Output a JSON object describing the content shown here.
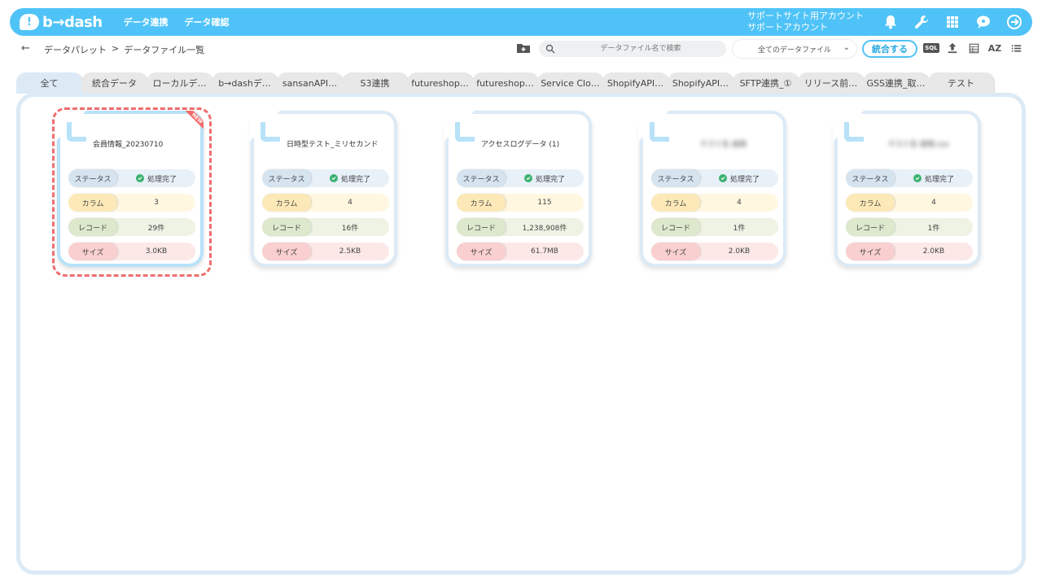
{
  "brand": {
    "name": "b→dash",
    "logo_mark": "!"
  },
  "topnav": [
    "データ連携",
    "データ確認"
  ],
  "account": {
    "line1": "サポートサイト用アカウント",
    "line2": "サポートアカウント"
  },
  "top_icons": [
    "bell-icon",
    "wrench-icon",
    "grid-icon",
    "chat-icon",
    "logout-icon"
  ],
  "breadcrumb": {
    "parent": "データパレット",
    "separator": ">",
    "current": "データファイル一覧"
  },
  "search": {
    "placeholder": "データファイル名で検索"
  },
  "filter": {
    "selected": "全てのデータファイル"
  },
  "toolbar": {
    "merge_label": "統合する",
    "sql_label": "SQL",
    "sort_label": "AZ"
  },
  "tabs": [
    "全て",
    "統合データ",
    "ローカルデ…",
    "b→dashデ…",
    "sansanAPI…",
    "S3連携",
    "futureshop…",
    "futureshop…",
    "Service Clo…",
    "ShopifyAPI…",
    "ShopifyAPI…",
    "SFTP連携_①",
    "リリース前…",
    "GSS連携_取…",
    "テスト"
  ],
  "active_tab": "全て",
  "labels": {
    "status": "ステータス",
    "column": "カラム",
    "record": "レコード",
    "size": "サイズ"
  },
  "new_badge": "NEW",
  "files": [
    {
      "name": "会員情報_20230710",
      "status": "処理完了",
      "columns": "3",
      "records": "29件",
      "size": "3.0KB",
      "is_new": true,
      "selected": true,
      "name_blurred": false
    },
    {
      "name": "日時型テスト_ミリセカンド",
      "status": "処理完了",
      "columns": "4",
      "records": "16件",
      "size": "2.5KB",
      "is_new": false,
      "selected": false,
      "name_blurred": false
    },
    {
      "name": "アクセスログデータ (1)",
      "status": "処理完了",
      "columns": "115",
      "records": "1,238,908件",
      "size": "61.7MB",
      "is_new": false,
      "selected": false,
      "name_blurred": false
    },
    {
      "name": "テスト生 成用",
      "status": "処理完了",
      "columns": "4",
      "records": "1件",
      "size": "2.0KB",
      "is_new": false,
      "selected": false,
      "name_blurred": true
    },
    {
      "name": "テスト生 成用.csv",
      "status": "処理完了",
      "columns": "4",
      "records": "1件",
      "size": "2.0KB",
      "is_new": false,
      "selected": false,
      "name_blurred": true
    }
  ]
}
